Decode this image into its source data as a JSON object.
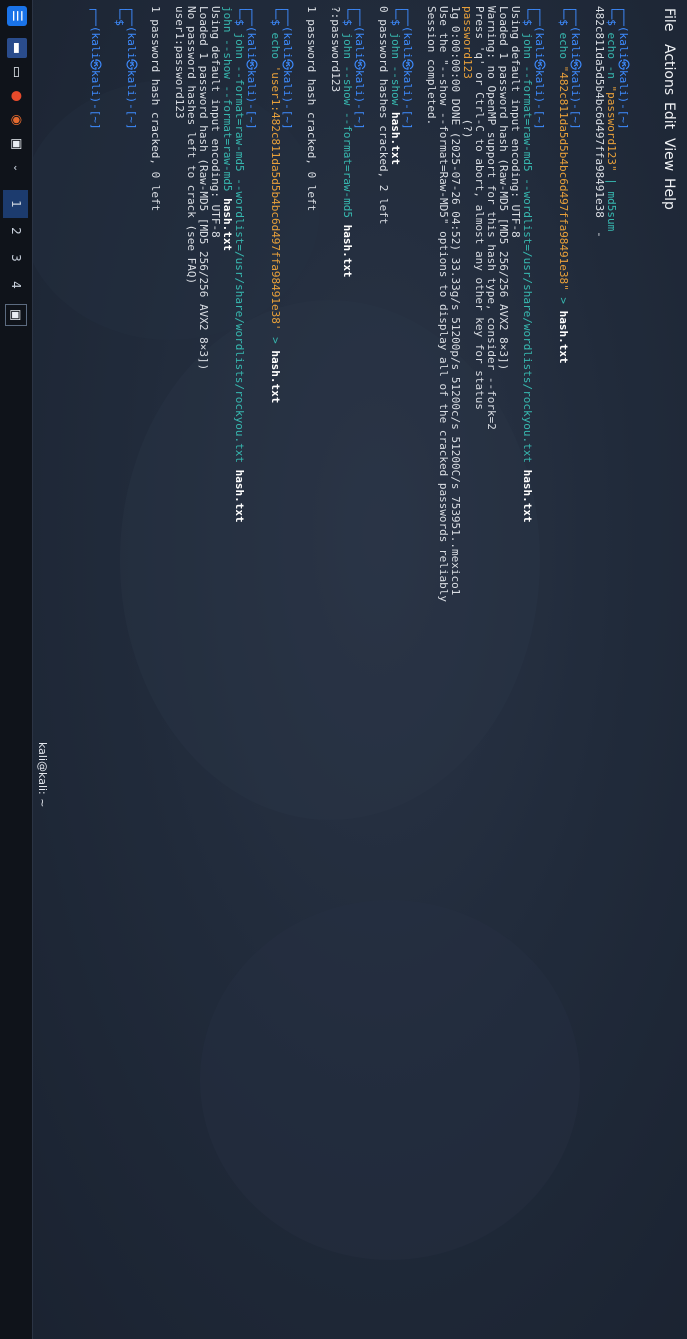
{
  "window_title": "kali@kali: ~",
  "menu": [
    "File",
    "Actions",
    "Edit",
    "View",
    "Help"
  ],
  "taskbar": {
    "workspaces": [
      "1",
      "2",
      "3",
      "4"
    ]
  },
  "prompt": {
    "head": "┌──(kali㉿kali)-[~]",
    "dollar": "└─$"
  },
  "terminal": {
    "b1": {
      "c1": "echo",
      "c2": "-n",
      "str": "\"password123\"",
      "pipe": " | md5sum",
      "out1": "482c811da5d5b4bc6d497ffa98491e38  -"
    },
    "b2": {
      "c1": "echo",
      "str": "\"482c811da5d5b4bc6d497ffa98491e38\"",
      "redir": " > ",
      "file": "hash.txt"
    },
    "b3": {
      "c1": "john",
      "opts": "--format=raw-md5 --wordlist=/usr/share/wordlists/rockyou.txt ",
      "file": "hash.txt",
      "out": [
        "Using default input encoding: UTF-8",
        "Loaded 1 password hash (Raw-MD5 [MD5 256/256 AVX2 8×3])",
        "Warning: no OpenMP support for this hash type, consider --fork=2",
        "Press 'q' or Ctrl-C to abort, almost any other key for status"
      ],
      "pw": "password123",
      "pw_suffix": "      (?)",
      "out2": [
        "1g 0:00:00:00 DONE (2025-07-26 04:52) 33.33g/s 51200p/s 51200c/s 51200C/s 753951..mexico1",
        "Use the \"--show --format=Raw-MD5\" options to display all of the cracked passwords reliably",
        "Session completed."
      ]
    },
    "b4": {
      "c1": "john",
      "opts": "--show ",
      "file": "hash.txt",
      "out1": "0 password hashes cracked, 2 left"
    },
    "b5": {
      "c1": "john",
      "opts": "--show --format=raw-md5 ",
      "file": "hash.txt",
      "out": [
        "?:password123",
        "",
        "1 password hash cracked, 0 left"
      ]
    },
    "b6": {
      "c1": "echo",
      "str": "'user1:482c811da5d5b4bc6d497ffa98491e38'",
      "redir": " > ",
      "file": "hash.txt"
    },
    "b7": {
      "c1": "john",
      "opts": "--format=raw-md5 --wordlist=/usr/share/wordlists/rockyou.txt ",
      "file": "hash.txt"
    },
    "b8": {
      "c1": "john",
      "opts": "--show --format=raw-md5 ",
      "file": "hash.txt",
      "out": [
        "Using default input encoding: UTF-8",
        "Loaded 1 password hash (Raw-MD5 [MD5 256/256 AVX2 8×3])",
        "No password hashes left to crack (see FAQ)",
        "user1:password123",
        "",
        "1 password hash cracked, 0 left"
      ]
    }
  }
}
